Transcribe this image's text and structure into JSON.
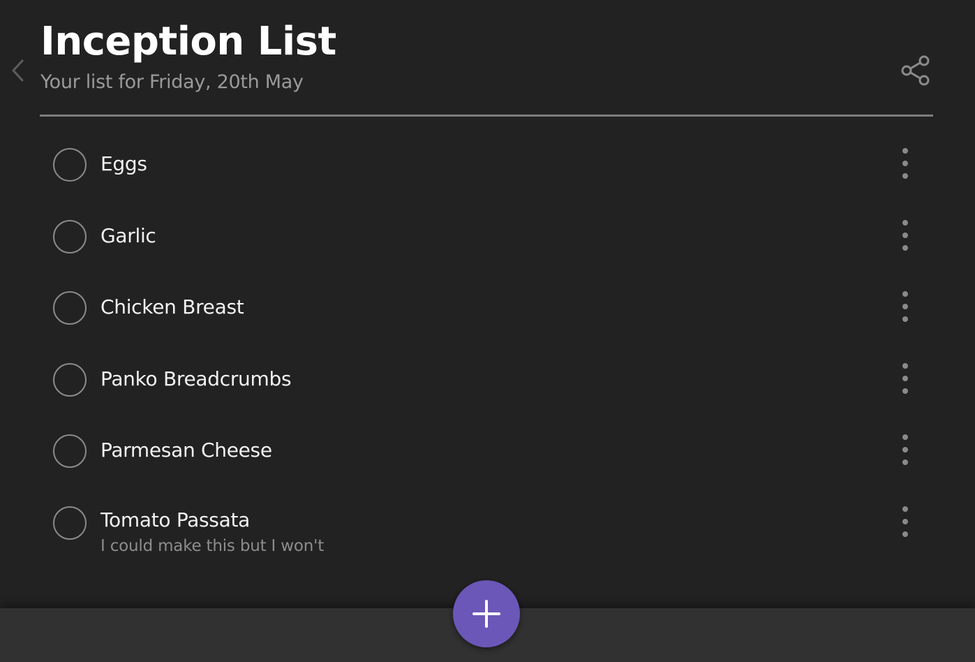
{
  "header": {
    "title": "Inception List",
    "subtitle": "Your list for Friday, 20th May"
  },
  "icons": {
    "back": "chevron-left-icon",
    "share": "share-icon",
    "item_menu": "more-vertical-icon",
    "add": "plus-icon"
  },
  "items": [
    {
      "label": "Eggs",
      "note": ""
    },
    {
      "label": "Garlic",
      "note": ""
    },
    {
      "label": "Chicken Breast",
      "note": ""
    },
    {
      "label": "Panko Breadcrumbs",
      "note": ""
    },
    {
      "label": "Parmesan Cheese",
      "note": ""
    },
    {
      "label": "Tomato Passata",
      "note": "I could make this but I won't"
    }
  ],
  "colors": {
    "background": "#222222",
    "bottom_bar": "#313131",
    "accent": "#6b57b8",
    "title": "#ffffff",
    "subtitle": "#9a9a9a",
    "muted_icon": "#8a8a8a"
  }
}
